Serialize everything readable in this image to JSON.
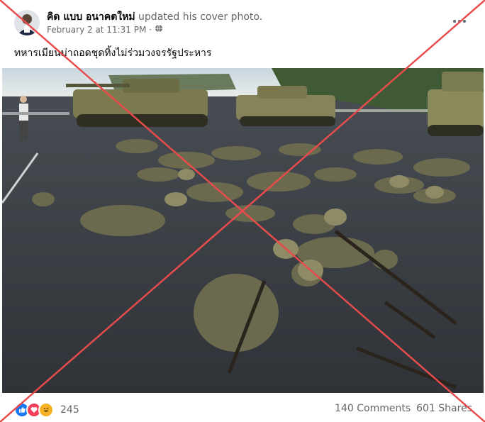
{
  "post": {
    "author": "คิด แบบ อนาคตใหม่",
    "action": "updated his cover photo.",
    "timestamp": "February 2 at 11:31 PM",
    "separator": "·",
    "audience_icon": "globe-icon",
    "more_icon": "more-dots-icon",
    "caption": "ทหารเมียนม่าถอดชุดทิ้งไม่ร่วมวงจรรัฐประหาร",
    "photo_description_icon": "photo",
    "reactions": {
      "icons": [
        "like-icon",
        "love-icon",
        "haha-icon"
      ],
      "count": "245"
    },
    "comments": "140 Comments",
    "shares": "601 Shares"
  },
  "colors": {
    "x_mark": "#e84b4b",
    "link_blue": "#1877f2",
    "text_secondary": "#65676b"
  }
}
